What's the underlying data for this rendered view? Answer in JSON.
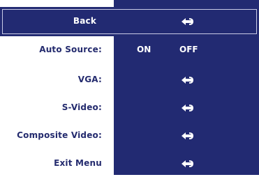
{
  "menu": {
    "back": {
      "label": "Back",
      "icon": "enter-arrow-icon"
    },
    "auto_source": {
      "label": "Auto Source:",
      "on": "ON",
      "off": "OFF"
    },
    "vga": {
      "label": "VGA:",
      "icon": "enter-arrow-icon"
    },
    "svideo": {
      "label": "S-Video:",
      "icon": "enter-arrow-icon"
    },
    "composite": {
      "label": "Composite Video:",
      "icon": "enter-arrow-icon"
    },
    "exit": {
      "label": "Exit Menu",
      "icon": "enter-arrow-icon"
    }
  },
  "colors": {
    "panel": "#222a72",
    "label_text": "#242b6e",
    "selected_text": "#ffffff"
  }
}
